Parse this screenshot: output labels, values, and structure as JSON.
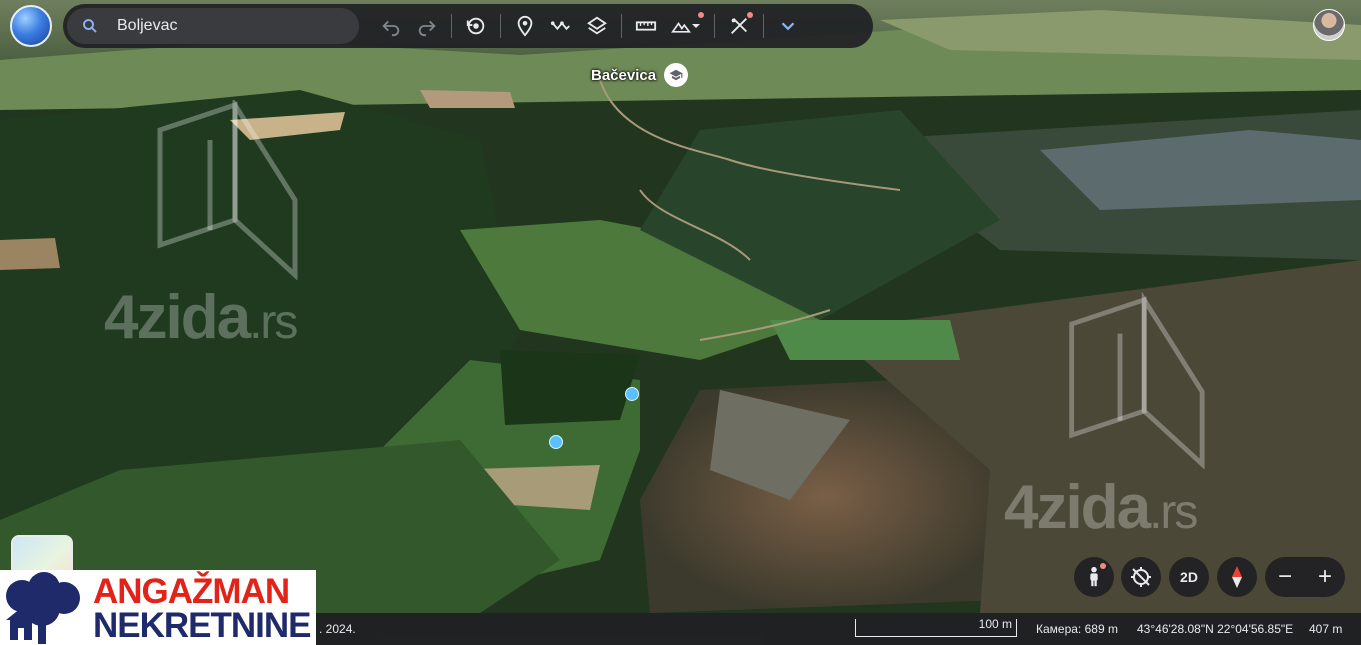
{
  "toolbar": {
    "search_value": "Boljevac",
    "icons": [
      "search-icon",
      "undo-icon",
      "redo-icon",
      "history-icon",
      "pin-icon",
      "path-icon",
      "layers-icon",
      "ruler-icon",
      "terrain-icon",
      "tools-icon",
      "chevron-down-icon"
    ]
  },
  "map": {
    "place_label": "Bačevica",
    "watermark_main": "4zida",
    "watermark_suffix": ".rs"
  },
  "controls": {
    "view_mode_label": "2D",
    "zoom_out_label": "−",
    "zoom_in_label": "+"
  },
  "status": {
    "date": ". 2024.",
    "scale_label": "100 m",
    "camera": "Камера: 689 m",
    "coordinates": "43°46'28.08\"N 22°04'56.85\"E",
    "elevation": "407 m"
  },
  "logo": {
    "line1": "ANGAŽMAN",
    "line2": "NEKRETNINE"
  },
  "colors": {
    "toolbar_bg": "#202124",
    "marker": "#5bc0ff",
    "logo_red": "#e2231a",
    "logo_blue": "#1f2a6b"
  }
}
